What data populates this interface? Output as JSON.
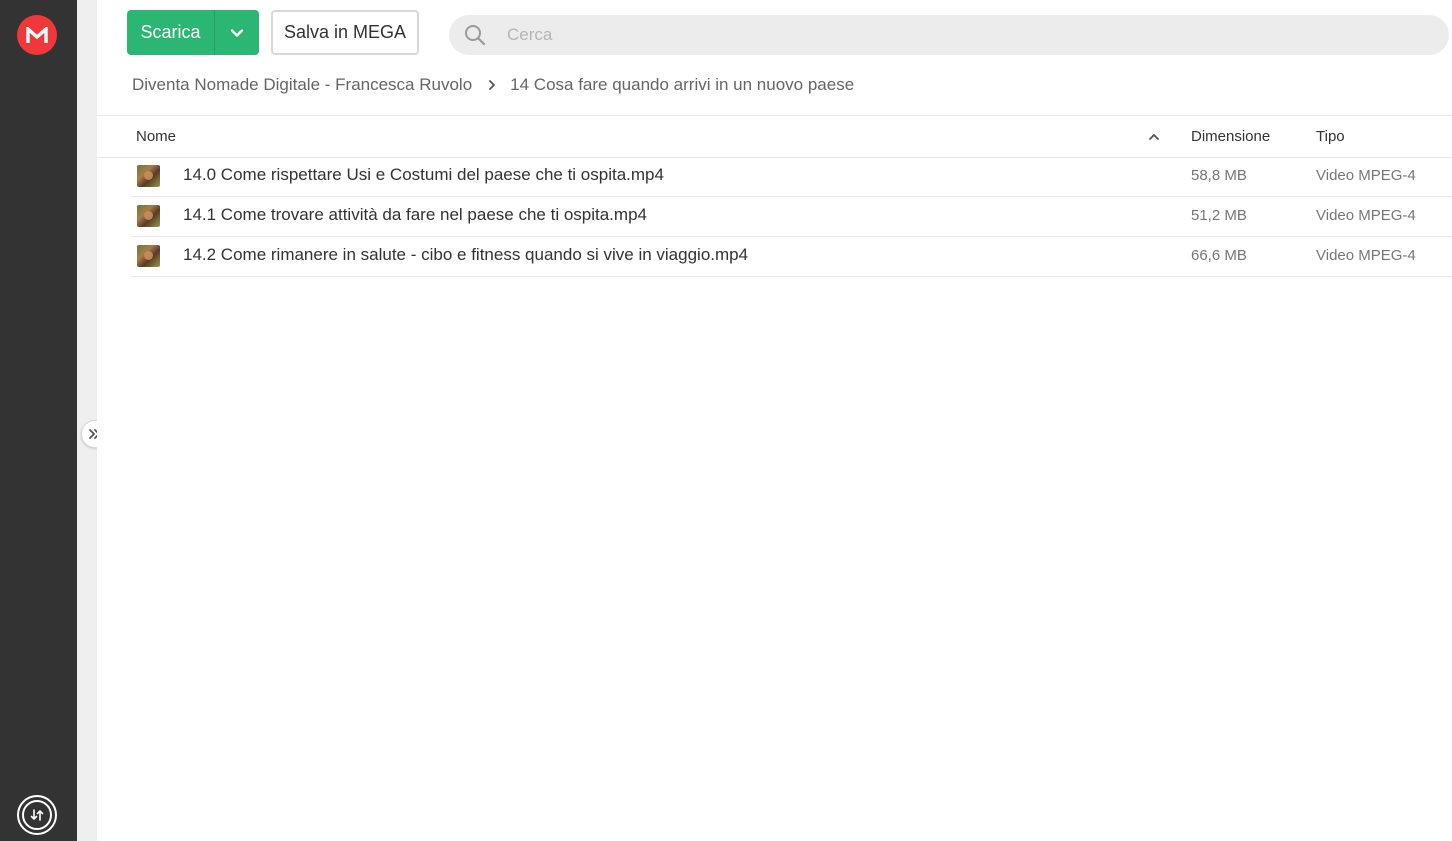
{
  "colors": {
    "sidebar_bg": "#333333",
    "brand": "#f0373a",
    "download_button": "#2bb673",
    "search_bg": "#ececec"
  },
  "icons": {
    "logo": "mega-logo-icon",
    "transfer": "transfer-icon",
    "download_arrow": "chevron-down-icon",
    "search": "search-icon",
    "breadcrumb_separator": "chevron-right-icon",
    "expand": "double-chevron-right-icon",
    "sort": "chevron-up-icon",
    "file": "video-thumbnail-icon"
  },
  "toolbar": {
    "download_label": "Scarica",
    "save_label": "Salva in MEGA"
  },
  "search": {
    "placeholder": "Cerca",
    "value": ""
  },
  "breadcrumb": {
    "parent": "Diventa Nomade Digitale - Francesca Ruvolo",
    "current": "14 Cosa fare quando arrivi in un nuovo paese"
  },
  "table": {
    "headers": {
      "name": "Nome",
      "size": "Dimensione",
      "type": "Tipo"
    },
    "rows": [
      {
        "name": "14.0 Come rispettare Usi e Costumi del paese che ti ospita.mp4",
        "size": "58,8 MB",
        "type": "Video MPEG-4"
      },
      {
        "name": "14.1 Come trovare attività da fare nel paese che ti ospita.mp4",
        "size": "51,2 MB",
        "type": "Video MPEG-4"
      },
      {
        "name": "14.2 Come rimanere in salute - cibo e fitness quando si vive in viaggio.mp4",
        "size": "66,6 MB",
        "type": "Video MPEG-4"
      }
    ]
  }
}
